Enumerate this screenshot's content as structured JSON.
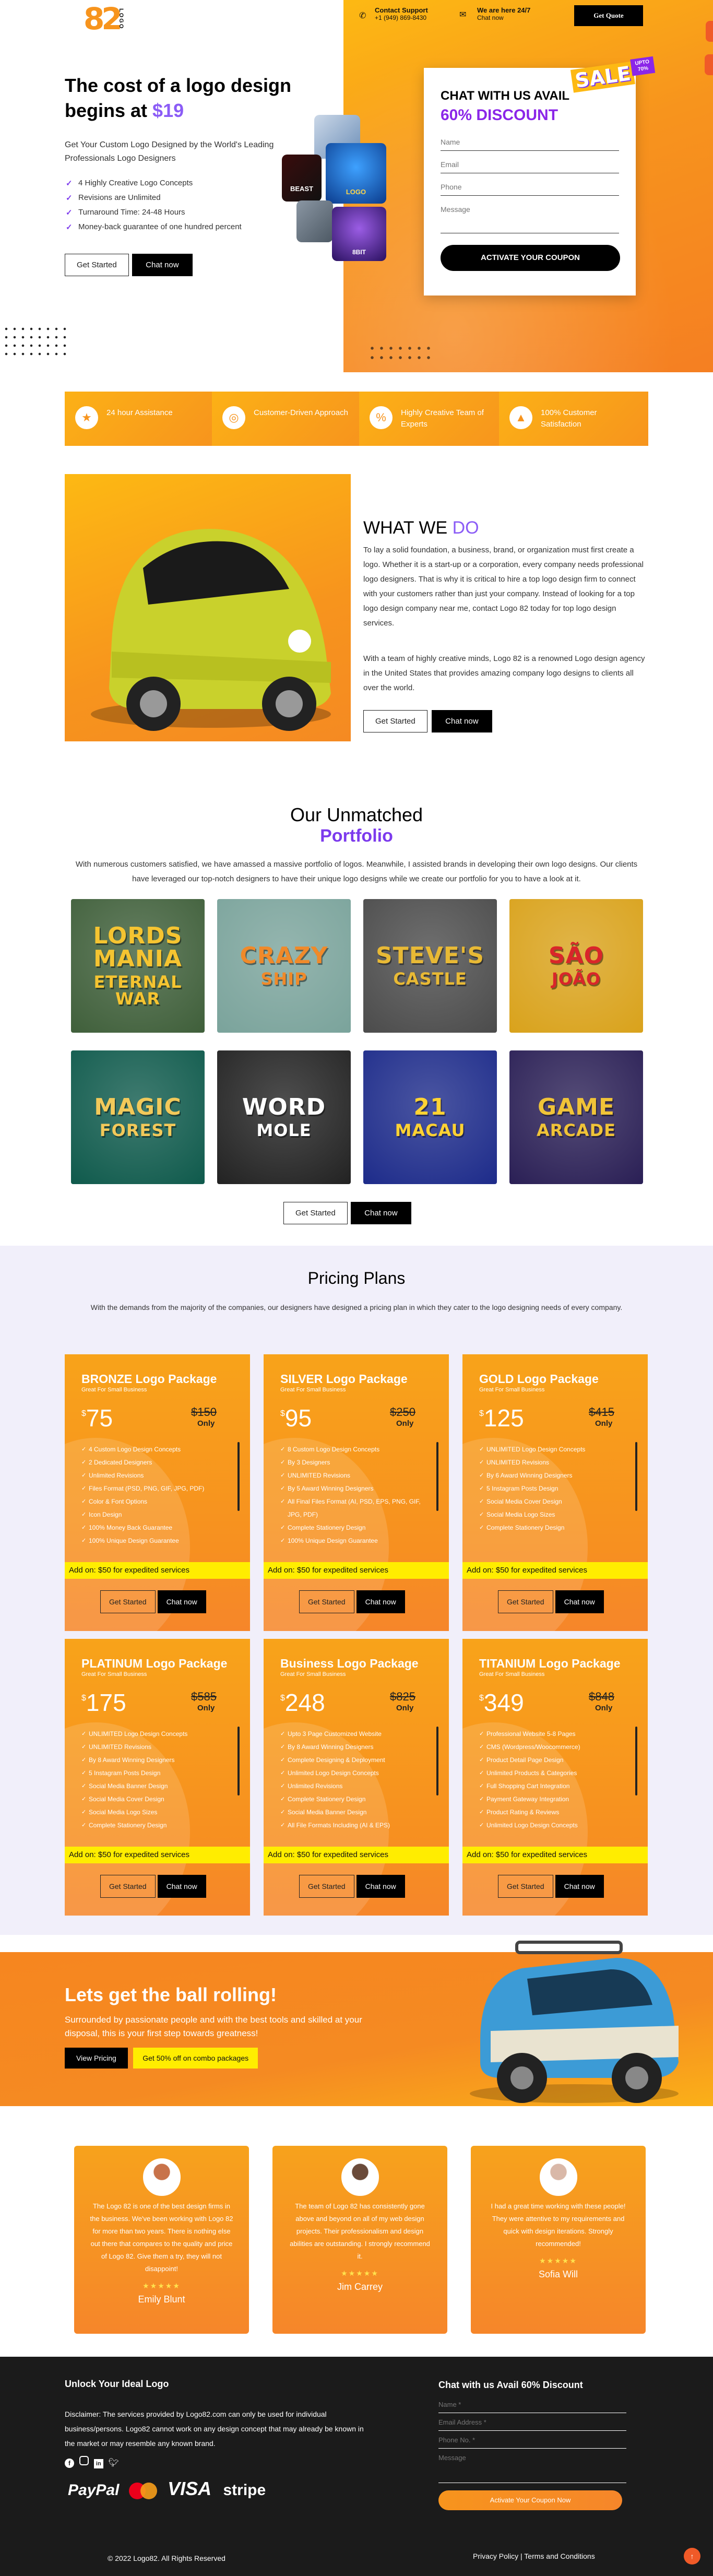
{
  "brand": {
    "mark_digits": "82",
    "mark_word": "LOGO"
  },
  "header": {
    "support_title": "Contact Support",
    "support_phone": "+1 (949) 869-8430",
    "chat_title": "We are here 24/7",
    "chat_sub": "Chat now",
    "quote_button": "Get Quote",
    "accent": "#f7941d",
    "purple": "#8b5cf6"
  },
  "hero": {
    "title_part1": "The cost of a logo design",
    "title_part2": "begins at",
    "title_price": "$19",
    "subtitle": "Get Your Custom Logo Designed by the World's Leading Professionals Logo Designers",
    "checks": [
      "4 Highly Creative Logo Concepts",
      "Revisions are Unlimited",
      "Turnaround Time: 24-48 Hours",
      "Money-back guarantee of one hundred percent"
    ],
    "get_started": "Get Started",
    "chat_now": "Chat now",
    "logo_cards": [
      "BEAST",
      "LOGO",
      "8BIT",
      "LOGO"
    ]
  },
  "offer_form": {
    "title": "CHAT WITH US AVAIL",
    "discount": "60% DISCOUNT",
    "sale_badge": "SALE",
    "sale_small": "UPTO 70%",
    "placeholders": {
      "name": "Name",
      "email": "Email",
      "phone": "Phone",
      "message": "Message"
    },
    "submit": "ACTIVATE YOUR COUPON"
  },
  "features": [
    {
      "icon": "medal-icon",
      "glyph": "★",
      "label": "24 hour Assistance"
    },
    {
      "icon": "target-icon",
      "glyph": "◎",
      "label": "Customer-Driven Approach"
    },
    {
      "icon": "percent-icon",
      "glyph": "%",
      "label": "Highly Creative Team of Experts"
    },
    {
      "icon": "mountain-icon",
      "glyph": "▲",
      "label": "100% Customer Satisfaction"
    }
  ],
  "what_we_do": {
    "title_plain": "WHAT WE",
    "title_accent": "DO",
    "para1": "To lay a solid foundation, a business, brand, or organization must first create a logo. Whether it is a start-up or a corporation, every company needs professional logo designers. That is why it is critical to hire a top logo design firm to connect with your customers rather than just your company. Instead of looking for a top logo design company near me, contact Logo 82 today for top logo design services.",
    "para2": "With a team of highly creative minds, Logo 82 is a renowned Logo design agency in the United States that provides amazing company logo designs to clients all over the world.",
    "get_started": "Get Started",
    "chat_now": "Chat now"
  },
  "portfolio": {
    "title": "Our Unmatched",
    "accent": "Portfolio",
    "description": "With numerous customers satisfied, we have amassed a massive portfolio of logos. Meanwhile, I assisted brands in developing their own logo designs. Our clients have leveraged our top-notch designers to have their unique logo designs while we create our portfolio for you to have a look at it.",
    "items": [
      {
        "line1": "LORDS MANIA",
        "line2": "ETERNAL WAR",
        "bg": "#3f5f3a",
        "fg": "#f5c431"
      },
      {
        "line1": "CRAZY",
        "line2": "SHIP",
        "bg": "#7aa39b",
        "fg": "#f08a2a"
      },
      {
        "line1": "STEVE'S",
        "line2": "CASTLE",
        "bg": "#4b4b4b",
        "fg": "#e8b935"
      },
      {
        "line1": "SÃO",
        "line2": "JOÃO",
        "bg": "#d9a21b",
        "fg": "#d9262a"
      },
      {
        "line1": "MAGIC",
        "line2": "FOREST",
        "bg": "#0f5a4c",
        "fg": "#f2c95a"
      },
      {
        "line1": "WORD",
        "line2": "MOLE",
        "bg": "#222222",
        "fg": "#ffffff"
      },
      {
        "line1": "21",
        "line2": "MACAU",
        "bg": "#1d2b8a",
        "fg": "#ffd233"
      },
      {
        "line1": "GAME",
        "line2": "ARCADE",
        "bg": "#2a1f55",
        "fg": "#f0c338"
      }
    ],
    "get_started": "Get Started",
    "chat_now": "Chat now"
  },
  "pricing": {
    "title": "Pricing Plans",
    "description": "With the demands from the majority of the companies, our designers have designed a pricing plan in which they cater to the logo designing needs of every company.",
    "addon": "Add on: $50 for expedited services",
    "only": "Only",
    "get_started": "Get Started",
    "chat_now": "Chat now",
    "plans": [
      {
        "name": "BRONZE Logo Package",
        "tag": "Great For Small Business",
        "price": "75",
        "old": "$150",
        "features": [
          "4 Custom Logo Design Concepts",
          "2 Dedicated Designers",
          "Unlimited Revisions",
          "Files Format (PSD, PNG, GIF, JPG, PDF)",
          "Color & Font Options",
          "Icon Design",
          "100% Money Back Guarantee",
          "100% Unique Design Guarantee"
        ]
      },
      {
        "name": "SILVER Logo Package",
        "tag": "Great For Small Business",
        "price": "95",
        "old": "$250",
        "features": [
          "8 Custom Logo Design Concepts",
          "By 3 Designers",
          "UNLIMITED Revisions",
          "By 5 Award Winning Designers",
          "All Final Files Format (AI, PSD, EPS, PNG, GIF, JPG, PDF)",
          "Complete Stationery Design",
          "100% Unique Design Guarantee"
        ]
      },
      {
        "name": "GOLD Logo Package",
        "tag": "Great For Small Business",
        "price": "125",
        "old": "$415",
        "features": [
          "UNLIMITED Logo Design Concepts",
          "UNLIMITED Revisions",
          "By 6 Award Winning Designers",
          "5 Instagram Posts Design",
          "Social Media Cover Design",
          "Social Media Logo Sizes",
          "Complete Stationery Design"
        ]
      },
      {
        "name": "PLATINUM Logo Package",
        "tag": "Great For Small Business",
        "price": "175",
        "old": "$585",
        "features": [
          "UNLIMITED Logo Design Concepts",
          "UNLIMITED Revisions",
          "By 8 Award Winning Designers",
          "5 Instagram Posts Design",
          "Social Media Banner Design",
          "Social Media Cover Design",
          "Social Media Logo Sizes",
          "Complete Stationery Design"
        ]
      },
      {
        "name": "Business Logo Package",
        "tag": "Great For Small Business",
        "price": "248",
        "old": "$825",
        "features": [
          "Upto 3 Page Customized Website",
          "By 8 Award Winning Designers",
          "Complete Designing & Deployment",
          "Unlimited Logo Design Concepts",
          "Unlimited Revisions",
          "Complete Stationery Design",
          "Social Media Banner Design",
          "All File Formats Including (AI & EPS)"
        ]
      },
      {
        "name": "TITANIUM Logo Package",
        "tag": "Great For Small Business",
        "price": "349",
        "old": "$848",
        "features": [
          "Professional Website 5-8 Pages",
          "CMS (Wordpress/Woocommerce)",
          "Product Detail Page Design",
          "Unlimited Products & Categories",
          "Full Shopping Cart Integration",
          "Payment Gateway Integration",
          "Product Rating & Reviews",
          "Unlimited Logo Design Concepts"
        ]
      }
    ]
  },
  "cta": {
    "title": "Lets get the ball rolling!",
    "text": "Surrounded by passionate people and with the best tools and skilled at your disposal, this is your first step towards greatness!",
    "view_pricing": "View Pricing",
    "combo": "Get 50% off on combo packages"
  },
  "testimonials": [
    {
      "text": "The Logo 82 is one of the best design firms in the business. We've been working with Logo 82 for more than two years. There is nothing else out there that compares to the quality and price of Logo 82. Give them a try, they will not disappoint!",
      "name": "Emily Blunt",
      "stars": "★★★★★"
    },
    {
      "text": "The team of Logo 82 has consistently gone above and beyond on all of my web design projects. Their professionalism and design abilities are outstanding. I strongly recommend it.",
      "name": "Jim Carrey",
      "stars": "★★★★★"
    },
    {
      "text": "I had a great time working with these people! They were attentive to my requirements and quick with design iterations. Strongly recommended!",
      "name": "Sofia Will",
      "stars": "★★★★★"
    }
  ],
  "footer": {
    "title": "Unlock Your Ideal Logo",
    "disclaimer": "Disclaimer: The services provided by Logo82.com can only be used for individual business/persons. Logo82 cannot work on any design concept that may already be known in the market or may resemble any known brand.",
    "social": [
      "facebook-icon",
      "instagram-icon",
      "linkedin-icon",
      "twitter-icon"
    ],
    "payments": [
      "PayPal",
      "VISA",
      "stripe"
    ],
    "form_title": "Chat with us Avail 60% Discount",
    "placeholders": {
      "name": "Name *",
      "email": "Email Address *",
      "phone": "Phone No. *",
      "message": "Message"
    },
    "submit": "Activate Your Coupon Now",
    "copyright": "© 2022 Logo82. All Rights Reserved",
    "policy": "Privacy Policy | Terms and Conditions"
  }
}
